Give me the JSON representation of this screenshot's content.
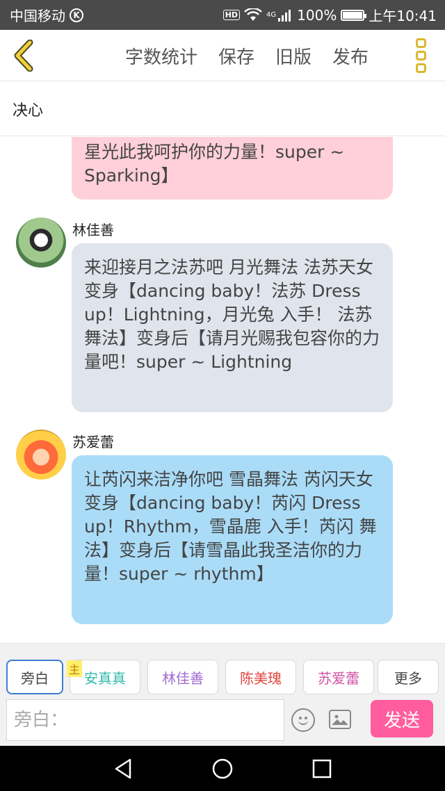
{
  "status_bar": {
    "carrier": "中国移动",
    "carrier_badge": "K",
    "hd_label": "HD",
    "network": "4G",
    "battery_percent": "100%",
    "time": "上午10:41",
    "battery_level": 1.0
  },
  "toolbar": {
    "actions": [
      "字数统计",
      "保存",
      "旧版",
      "发布"
    ],
    "accent_color": "#d9b82e"
  },
  "document": {
    "title": "决心"
  },
  "messages": [
    {
      "sender": "",
      "text": "星光此我呵护你的力量！super ~ Sparking】",
      "bubble_color": "#ffcfda"
    },
    {
      "sender": "林佳善",
      "text": "来迎接月之法苏吧 月光舞法 法苏天女 变身【dancing baby！法苏 Dress up！Lightning，月光兔 入手！ 法苏 舞法】变身后【请月光赐我包容你的力量吧！super ~ Lightning",
      "bubble_color": "#e0e5ed"
    },
    {
      "sender": "苏爱蕾",
      "text": "让芮闪来洁净你吧 雪晶舞法 芮闪天女 变身【dancing baby！芮闪 Dress up！Rhythm，雪晶鹿 入手！芮闪 舞法】变身后【请雪晶此我圣洁你的力量！super ~ rhythm】",
      "bubble_color": "#aadcf8"
    }
  ],
  "roles": {
    "narration": "旁白",
    "host_badge": "主",
    "anzhenzhen": "安真真",
    "linjiashan": "林佳善",
    "chenmeigui": "陈美瑰",
    "suailei": "苏爱蕾",
    "more": "更多"
  },
  "composer": {
    "placeholder": "旁白：",
    "send_label": "发送",
    "send_color": "#ff5d9e"
  }
}
